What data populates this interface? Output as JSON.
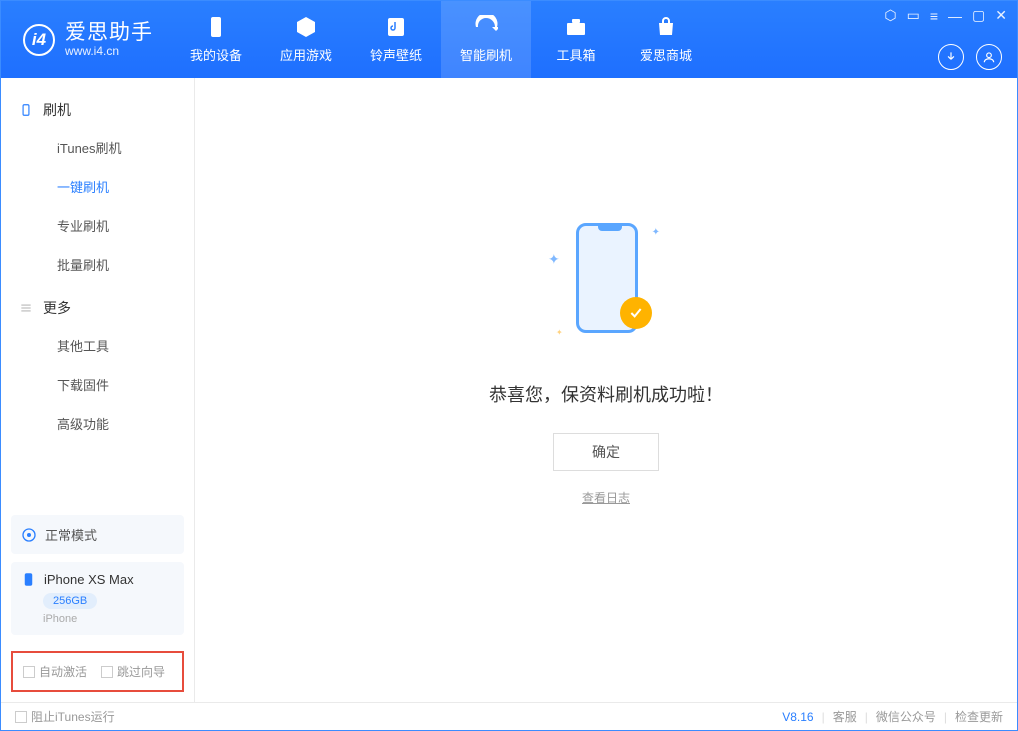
{
  "app": {
    "title": "爱思助手",
    "subtitle": "www.i4.cn"
  },
  "tabs": {
    "t0": "我的设备",
    "t1": "应用游戏",
    "t2": "铃声壁纸",
    "t3": "智能刷机",
    "t4": "工具箱",
    "t5": "爱思商城"
  },
  "sidebar": {
    "group1": "刷机",
    "g1": {
      "i0": "iTunes刷机",
      "i1": "一键刷机",
      "i2": "专业刷机",
      "i3": "批量刷机"
    },
    "group2": "更多",
    "g2": {
      "i0": "其他工具",
      "i1": "下载固件",
      "i2": "高级功能"
    },
    "mode": "正常模式",
    "device": {
      "name": "iPhone XS Max",
      "capacity": "256GB",
      "type": "iPhone"
    },
    "checks": {
      "c0": "自动激活",
      "c1": "跳过向导"
    }
  },
  "main": {
    "success": "恭喜您，保资料刷机成功啦！",
    "ok": "确定",
    "view_log": "查看日志"
  },
  "footer": {
    "block_itunes": "阻止iTunes运行",
    "version": "V8.16",
    "f0": "客服",
    "f1": "微信公众号",
    "f2": "检查更新"
  }
}
